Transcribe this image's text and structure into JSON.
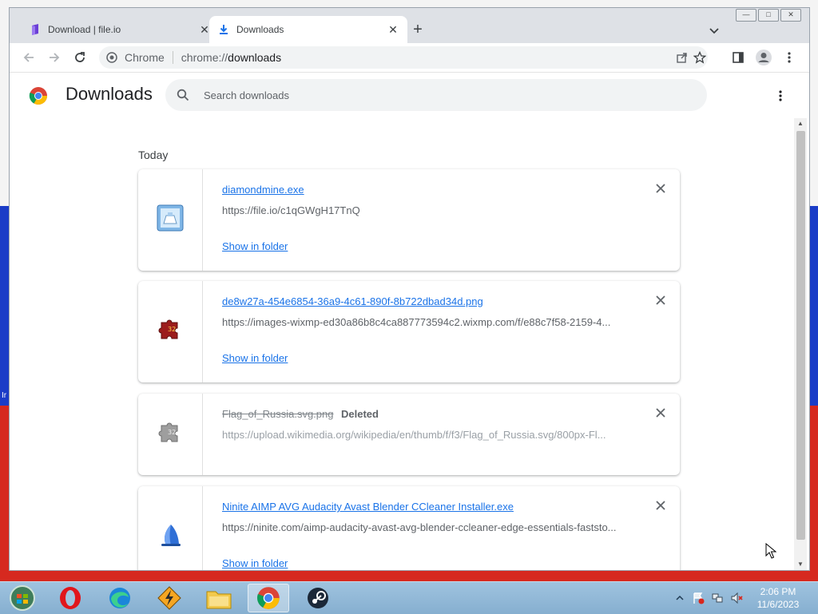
{
  "tabs": [
    {
      "label": "Download | file.io",
      "active": false,
      "icon": "fileio-logo-icon"
    },
    {
      "label": "Downloads",
      "active": true,
      "icon": "download-icon"
    }
  ],
  "toolbar": {
    "site_name": "Chrome",
    "url_scheme": "chrome://",
    "url_host": "downloads"
  },
  "page": {
    "title": "Downloads",
    "search_placeholder": "Search downloads",
    "section_label": "Today"
  },
  "downloads": [
    {
      "filename": "diamondmine.exe",
      "url": "https://file.io/c1qGWgH17TnQ",
      "action": "Show in folder",
      "status": "",
      "icon": "installer-icon"
    },
    {
      "filename": "de8w27a-454e6854-36a9-4c61-890f-8b722dbad34d.png",
      "url": "https://images-wixmp-ed30a86b8c4ca887773594c2.wixmp.com/f/e88c7f58-2159-4...",
      "action": "Show in folder",
      "status": "",
      "icon": "puzzle-icon"
    },
    {
      "filename": "Flag_of_Russia.svg.png",
      "url": "https://upload.wikimedia.org/wikipedia/en/thumb/f/f3/Flag_of_Russia.svg/800px-Fl...",
      "action": "",
      "status": "Deleted",
      "icon": "puzzle-grey-icon"
    },
    {
      "filename": "Ninite AIMP AVG Audacity Avast Blender CCleaner Installer.exe",
      "url": "https://ninite.com/aimp-audacity-avast-avg-blender-ccleaner-edge-essentials-faststo...",
      "action": "Show in folder",
      "status": "",
      "icon": "ninite-icon"
    }
  ],
  "taskbar": {
    "apps": [
      "start-orb",
      "opera",
      "edge",
      "winamp",
      "file-explorer",
      "chrome",
      "steam"
    ],
    "time": "2:06 PM",
    "date": "11/6/2023"
  },
  "desktop": {
    "partial_label": "Ir"
  },
  "colors": {
    "link": "#1a73e8",
    "flag_blue": "#1a3cc7",
    "flag_red": "#d6291f"
  }
}
